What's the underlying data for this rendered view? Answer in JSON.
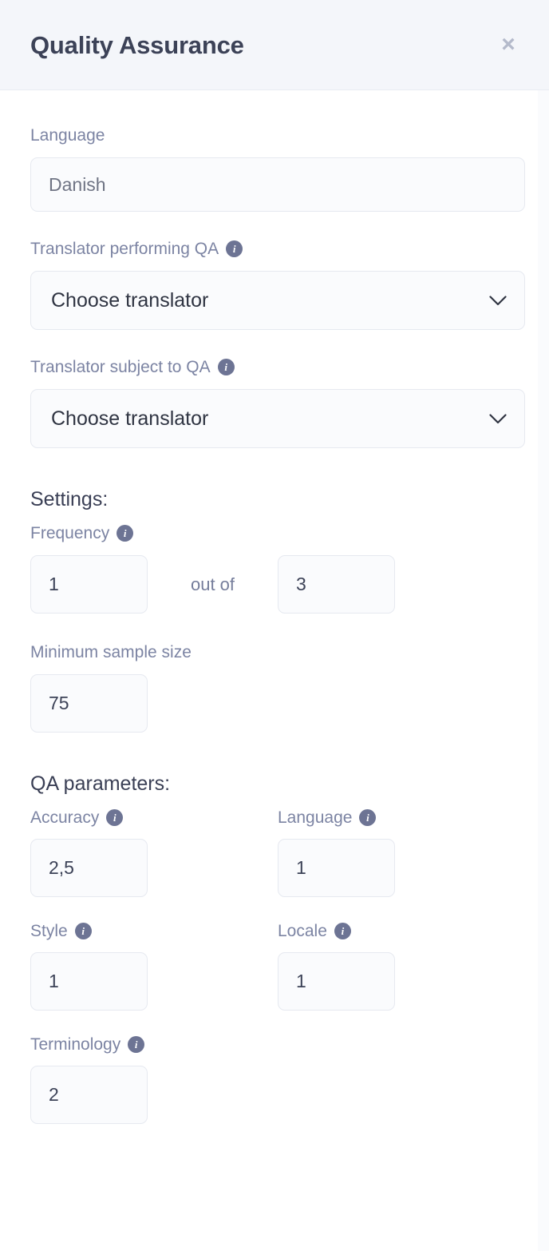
{
  "header": {
    "title": "Quality Assurance",
    "close_label": "×"
  },
  "colors": {
    "header_bg": "#f4f6fa",
    "title": "#3c4257",
    "label": "#7c84a3",
    "heading": "#3a3f55",
    "input_bg": "#fafbfd",
    "input_border": "#e6e9f0",
    "info_icon_bg": "#6d7494",
    "close_icon": "#b4bacb"
  },
  "icons": {
    "info": "i",
    "chevron_down": "chevron-down-icon",
    "close": "close-icon"
  },
  "form": {
    "language": {
      "label": "Language",
      "value": "Danish",
      "placeholder": "Language"
    },
    "translator_performing": {
      "label": "Translator performing QA",
      "value": "Choose translator",
      "has_info": true
    },
    "translator_subject": {
      "label": "Translator subject to QA",
      "value": "Choose translator",
      "has_info": true
    }
  },
  "settings": {
    "heading": "Settings:",
    "frequency": {
      "label": "Frequency",
      "has_info": true,
      "numerator": "1",
      "separator": "out of",
      "denominator": "3"
    },
    "minimum_sample_size": {
      "label": "Minimum sample size",
      "has_info": false,
      "value": "75"
    }
  },
  "qa_parameters": {
    "heading": "QA parameters:",
    "items": [
      {
        "label": "Accuracy",
        "value": "2,5",
        "has_info": true
      },
      {
        "label": "Language",
        "value": "1",
        "has_info": true
      },
      {
        "label": "Style",
        "value": "1",
        "has_info": true
      },
      {
        "label": "Locale",
        "value": "1",
        "has_info": true
      },
      {
        "label": "Terminology",
        "value": "2",
        "has_info": true
      }
    ]
  }
}
